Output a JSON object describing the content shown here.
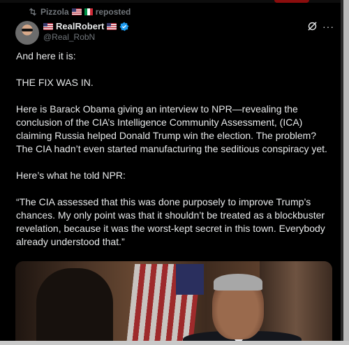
{
  "repost": {
    "reposter_name": "Pizzola",
    "label": "reposted"
  },
  "author": {
    "display_name": "RealRobert",
    "handle": "@Real_RobN"
  },
  "tweet": {
    "paragraphs": [
      "And here it is:",
      "THE FIX WAS IN.",
      "Here is Barack Obama giving an interview to NPR—revealing the conclusion of the CIA’s Intelligence Community Assessment, (ICA) claiming Russia helped Donald Trump win the election. The problem? The CIA hadn’t even started manufacturing the seditious conspiracy yet.",
      "Here’s what he told NPR:",
      "“The CIA assessed that this was done purposely to improve Trump’s chances. My only point was that it shouldn’t be treated as a blockbuster revelation, because it was the worst-kept secret in this town. Everybody already understood that.”"
    ]
  },
  "icons": {
    "repost": "repost-icon",
    "verified": "verified-badge-icon",
    "grok": "grok-icon",
    "more": "more-icon"
  },
  "colors": {
    "background": "#000000",
    "text": "#e7e9ea",
    "secondary_text": "#71767b",
    "verified_blue": "#1d9bf0"
  }
}
